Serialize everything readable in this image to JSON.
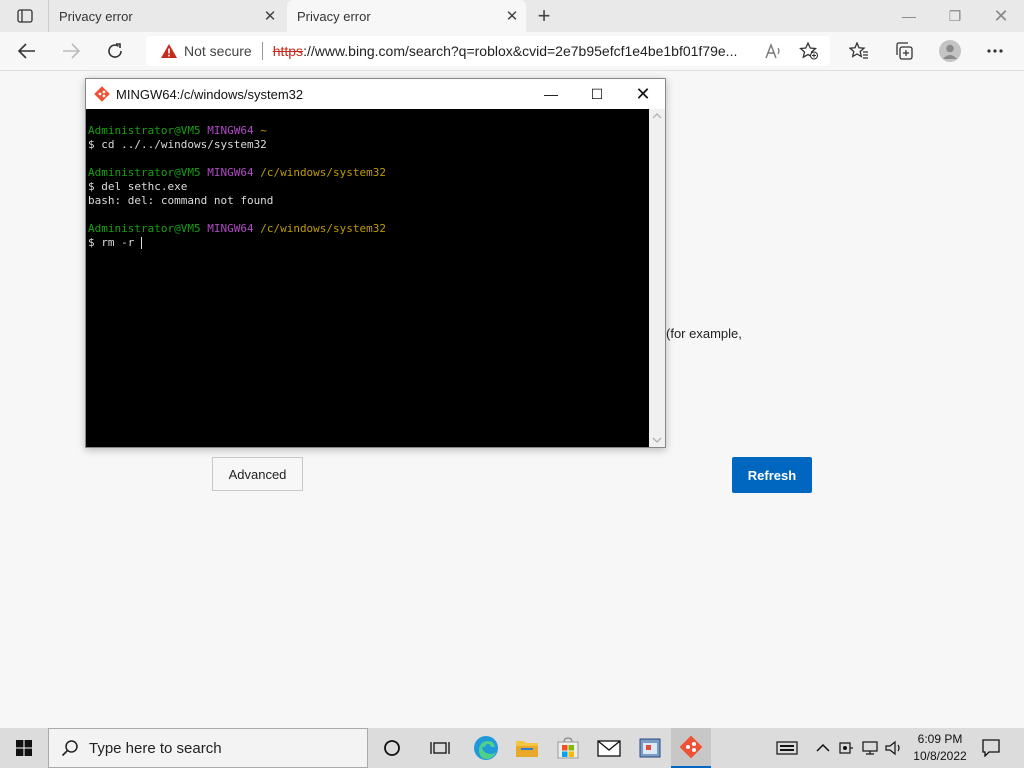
{
  "browser": {
    "tabs": [
      {
        "title": "Privacy error"
      },
      {
        "title": "Privacy error"
      }
    ],
    "address": {
      "security_label": "Not secure",
      "url_scheme": "https",
      "url_rest": "://www.bing.com/search?q=roblox&cvid=2e7b95efcf1e4be1bf01f79e..."
    }
  },
  "page": {
    "partial_text": "(for example,",
    "advanced_label": "Advanced",
    "refresh_label": "Refresh"
  },
  "terminal": {
    "title": "MINGW64:/c/windows/system32",
    "user_host": "Administrator@VM5",
    "env": "MINGW64",
    "lines": [
      {
        "path": "~",
        "command": "$ cd ../../windows/system32",
        "output": ""
      },
      {
        "path": "/c/windows/system32",
        "command": "$ del sethc.exe",
        "output": "bash: del: command not found"
      },
      {
        "path": "/c/windows/system32",
        "command": "$ rm -r ",
        "output": ""
      }
    ]
  },
  "taskbar": {
    "search_placeholder": "Type here to search",
    "time": "6:09 PM",
    "date": "10/8/2022"
  },
  "colors": {
    "accent": "#0067c0",
    "prompt_user": "#13a10e",
    "prompt_env": "#b148c6",
    "prompt_path": "#c19c00"
  }
}
